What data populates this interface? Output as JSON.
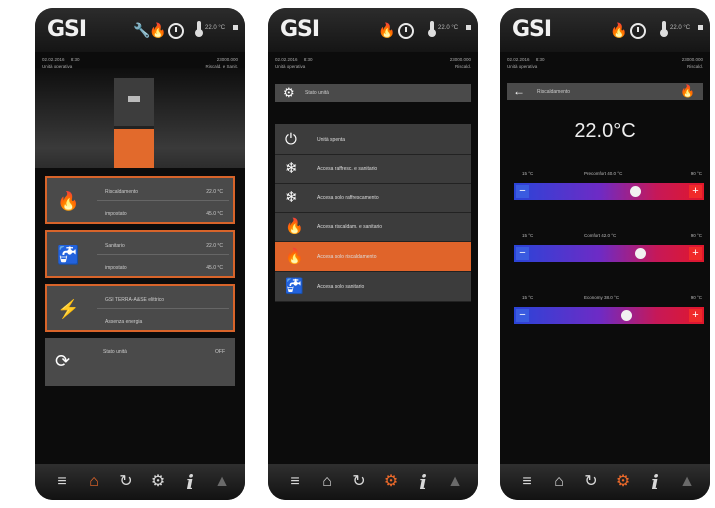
{
  "brand": "GSI",
  "status": {
    "date": "02.02.2016",
    "time": "8:30",
    "top_right": "23000.000",
    "left2": "Unità operativa",
    "p1_right": "Riscald. e Sanit.",
    "p2_right": "Riscald.",
    "top_temp": "22.0 °C"
  },
  "panel1": {
    "cards": [
      {
        "title": "Riscaldamento",
        "value": "22.0 °C",
        "sub": "impostato",
        "subval": "45.0 °C"
      },
      {
        "title": "Sanitario",
        "value": "22.0 °C",
        "sub": "impostato",
        "subval": "45.0 °C"
      },
      {
        "title": "GSI TERRA-A&SE elittrico",
        "sub": "Assenza energia"
      },
      {
        "title": "Stato unità",
        "value": "OFF"
      }
    ]
  },
  "panel2": {
    "header": "Stato unità",
    "menu": [
      "Unità spenta",
      "Accesa raffresc. e sanitario",
      "Accesa solo raffrescamento",
      "Accesa riscaldam. e sanitario",
      "Accesa solo riscaldamento",
      "Accesa solo sanitario"
    ]
  },
  "panel3": {
    "header": "Riscaldamento",
    "big_temp": "22.0°C",
    "sliders": [
      {
        "min": "15 °C",
        "label": "Precomfort 40.0 °C",
        "max": "90 °C",
        "level": 0.68
      },
      {
        "min": "15 °C",
        "label": "Comfort 42.0 °C",
        "max": "90 °C",
        "level": 0.72
      },
      {
        "min": "15 °C",
        "label": "Economy 38.0 °C",
        "max": "90 °C",
        "level": 0.62
      }
    ]
  }
}
